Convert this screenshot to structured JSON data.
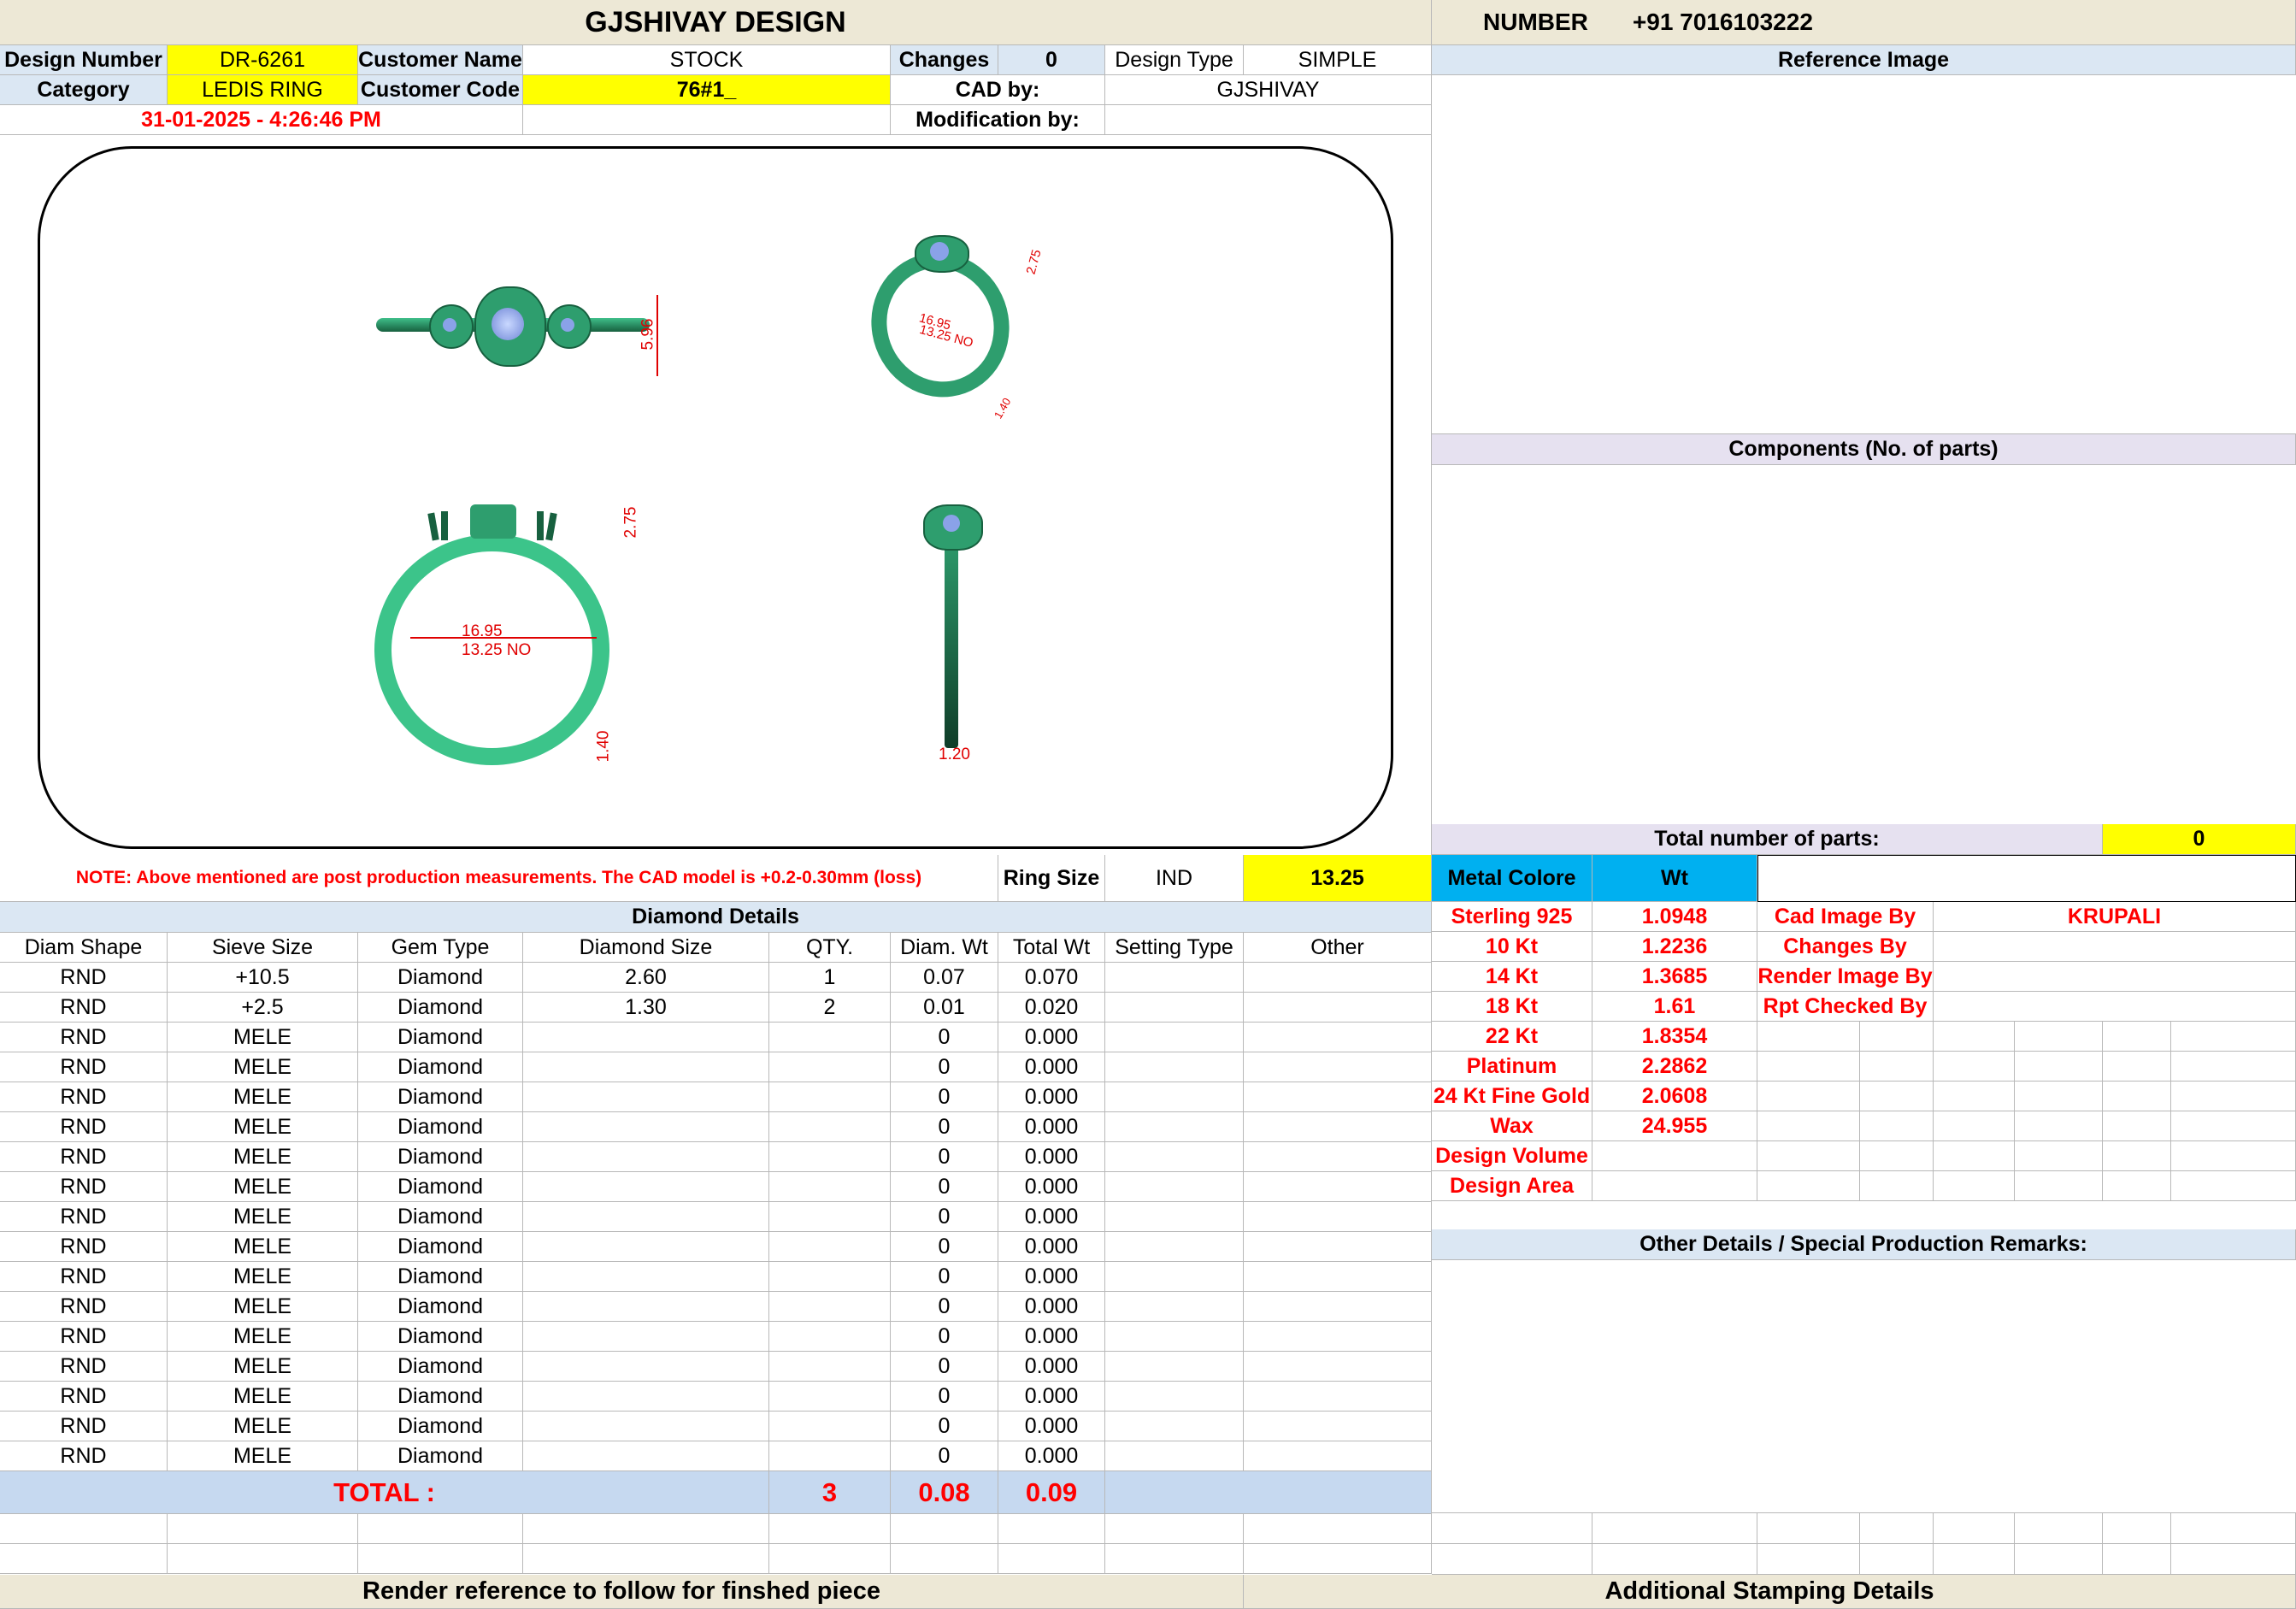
{
  "header": {
    "company": "GJSHIVAY DESIGN",
    "number_label": "NUMBER",
    "number_value": "+91 7016103222"
  },
  "info": {
    "design_number_label": "Design Number",
    "design_number": "DR-6261",
    "customer_name_label": "Customer Name",
    "customer_name": "STOCK",
    "changes_label": "Changes",
    "changes": "0",
    "design_type_label": "Design Type",
    "design_type": "SIMPLE",
    "category_label": "Category",
    "category": "LEDIS RING",
    "customer_code_label": "Customer Code",
    "customer_code": "76#1_",
    "cad_by_label": "CAD by:",
    "cad_by": "GJSHIVAY",
    "date": "31-01-2025 - 4:26:46 PM",
    "modification_label": "Modification by:",
    "modification": ""
  },
  "right_panel": {
    "reference_image": "Reference Image",
    "components": "Components (No. of parts)",
    "total_parts_label": "Total number of parts:",
    "total_parts": "0"
  },
  "drawing": {
    "dims": {
      "top_height": "5.96",
      "persp_diam": "16.95",
      "persp_size": "13.25 NO",
      "persp_h": "2.75",
      "persp_w": "1.40",
      "front_head": "2.75",
      "front_diam": "16.95",
      "front_size": "13.25 NO",
      "front_shank": "1.40",
      "side_width": "1.20"
    }
  },
  "note": {
    "text": "NOTE: Above mentioned are post production measurements. The CAD model is +0.2-0.30mm (loss)",
    "ring_size_label": "Ring Size",
    "ring_size_std": "IND",
    "ring_size": "13.25",
    "metal_label": "Metal Colore",
    "wt_label": "Wt"
  },
  "diamonds": {
    "title": "Diamond Details",
    "headers": [
      "Diam Shape",
      "Sieve Size",
      "Gem Type",
      "Diamond Size",
      "QTY.",
      "Diam. Wt",
      "Total Wt",
      "Setting Type",
      "Other"
    ],
    "rows": [
      [
        "RND",
        "+10.5",
        "Diamond",
        "2.60",
        "1",
        "0.07",
        "0.070",
        "",
        ""
      ],
      [
        "RND",
        "+2.5",
        "Diamond",
        "1.30",
        "2",
        "0.01",
        "0.020",
        "",
        ""
      ],
      [
        "RND",
        "MELE",
        "Diamond",
        "",
        "",
        "0",
        "0.000",
        "",
        ""
      ],
      [
        "RND",
        "MELE",
        "Diamond",
        "",
        "",
        "0",
        "0.000",
        "",
        ""
      ],
      [
        "RND",
        "MELE",
        "Diamond",
        "",
        "",
        "0",
        "0.000",
        "",
        ""
      ],
      [
        "RND",
        "MELE",
        "Diamond",
        "",
        "",
        "0",
        "0.000",
        "",
        ""
      ],
      [
        "RND",
        "MELE",
        "Diamond",
        "",
        "",
        "0",
        "0.000",
        "",
        ""
      ],
      [
        "RND",
        "MELE",
        "Diamond",
        "",
        "",
        "0",
        "0.000",
        "",
        ""
      ],
      [
        "RND",
        "MELE",
        "Diamond",
        "",
        "",
        "0",
        "0.000",
        "",
        ""
      ],
      [
        "RND",
        "MELE",
        "Diamond",
        "",
        "",
        "0",
        "0.000",
        "",
        ""
      ],
      [
        "RND",
        "MELE",
        "Diamond",
        "",
        "",
        "0",
        "0.000",
        "",
        ""
      ],
      [
        "RND",
        "MELE",
        "Diamond",
        "",
        "",
        "0",
        "0.000",
        "",
        ""
      ],
      [
        "RND",
        "MELE",
        "Diamond",
        "",
        "",
        "0",
        "0.000",
        "",
        ""
      ],
      [
        "RND",
        "MELE",
        "Diamond",
        "",
        "",
        "0",
        "0.000",
        "",
        ""
      ],
      [
        "RND",
        "MELE",
        "Diamond",
        "",
        "",
        "0",
        "0.000",
        "",
        ""
      ],
      [
        "RND",
        "MELE",
        "Diamond",
        "",
        "",
        "0",
        "0.000",
        "",
        ""
      ],
      [
        "RND",
        "MELE",
        "Diamond",
        "",
        "",
        "0",
        "0.000",
        "",
        ""
      ]
    ],
    "total_label": "TOTAL :",
    "total_qty": "3",
    "total_diam_wt": "0.08",
    "total_wt": "0.09"
  },
  "metals": [
    {
      "name": "Sterling 925",
      "wt": "1.0948"
    },
    {
      "name": "10 Kt",
      "wt": "1.2236"
    },
    {
      "name": "14 Kt",
      "wt": "1.3685"
    },
    {
      "name": "18 Kt",
      "wt": "1.61"
    },
    {
      "name": "22 Kt",
      "wt": "1.8354"
    },
    {
      "name": "Platinum",
      "wt": "2.2862"
    },
    {
      "name": "24 Kt Fine Gold",
      "wt": "2.0608"
    },
    {
      "name": "Wax",
      "wt": "24.955"
    },
    {
      "name": "Design Volume",
      "wt": ""
    },
    {
      "name": "Design Area",
      "wt": ""
    }
  ],
  "credits": [
    {
      "label": "Cad Image By",
      "value": "KRUPALI"
    },
    {
      "label": "Changes By",
      "value": ""
    },
    {
      "label": "Render Image By",
      "value": ""
    },
    {
      "label": "Rpt Checked By",
      "value": ""
    }
  ],
  "remarks": {
    "title": "Other Details / Special Production Remarks:"
  },
  "footer": {
    "left": "Render reference to follow for finshed piece",
    "right": "Additional Stamping Details"
  },
  "colors": {
    "metal": "#2e9e6e",
    "metal_dark": "#17603f",
    "dimension": "#e00000",
    "highlight": "#ffff00",
    "header_tan": "#ede8d6",
    "header_blue": "#dbe7f3",
    "total_blue": "#c6d9f0",
    "metal_header": "#00b0f0"
  }
}
